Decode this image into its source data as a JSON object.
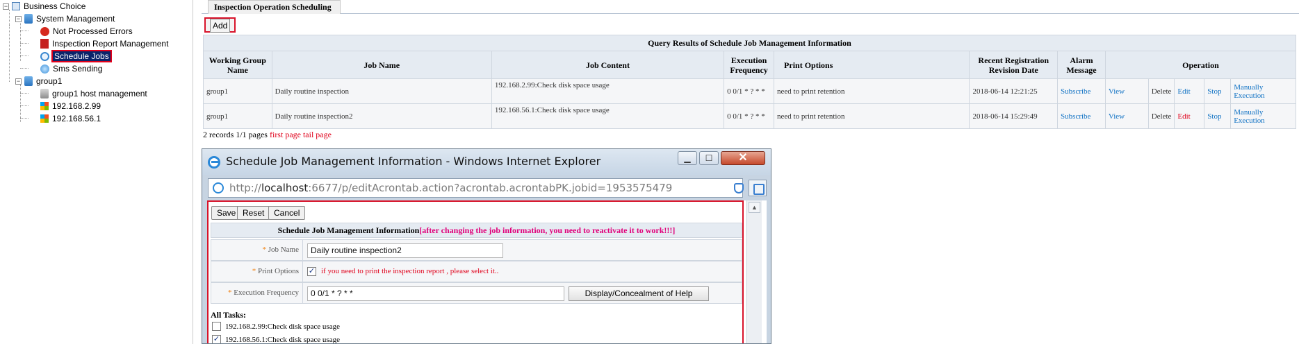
{
  "tree": {
    "root": "Business Choice",
    "system_management": "System Management",
    "not_processed_errors": "Not Processed Errors",
    "inspection_report_management": "Inspection Report Management",
    "schedule_jobs": "Schedule Jobs",
    "sms_sending": "Sms Sending",
    "group1": "group1",
    "group1_host_management": "group1 host management",
    "host1": "192.168.2.99",
    "host2": "192.168.56.1",
    "expand_glyph": "−"
  },
  "tab": {
    "label": "Inspection Operation Scheduling"
  },
  "toolbar": {
    "add_label": "Add"
  },
  "results": {
    "caption": "Query Results of Schedule Job Management Information",
    "columns": [
      "Working Group Name",
      "Job Name",
      "Job Content",
      "Execution Frequency",
      "Print Options",
      "Recent Registration Revision Date",
      "Alarm Message",
      "Operation"
    ],
    "rows": [
      {
        "group": "group1",
        "job_name": "Daily routine inspection",
        "job_content": "192.168.2.99:Check disk space usage",
        "frequency": "0 0/1 * ? * *",
        "print_options": "need to print retention",
        "date": "2018-06-14 12:21:25",
        "alarm": "Subscribe",
        "view": "View",
        "delete": "Delete",
        "edit": "Edit",
        "stop": "Stop",
        "manual": "Manually Execution"
      },
      {
        "group": "group1",
        "job_name": "Daily routine inspection2",
        "job_content": "192.168.56.1:Check disk space usage",
        "frequency": "0 0/1 * ? * *",
        "print_options": "need to print retention",
        "date": "2018-06-14 15:29:49",
        "alarm": "Subscribe",
        "view": "View",
        "delete": "Delete",
        "edit": "Edit",
        "stop": "Stop",
        "manual": "Manually Execution"
      }
    ]
  },
  "pager": {
    "summary": "2 records 1/1 pages",
    "first": "first page",
    "tail": "tail page"
  },
  "popup": {
    "title": "Schedule Job Management Information - Windows Internet Explorer",
    "address_prefix": "http://",
    "address_host": "localhost",
    "address_rest": ":6677/p/editAcrontab.action?acrontab.acrontabPK.jobid=1953575479",
    "minimize": "▁",
    "maximize": "☐",
    "close": "✕",
    "save": "Save",
    "reset": "Reset",
    "cancel": "Cancel",
    "form_title": "Schedule Job Management Information",
    "form_warning": "[after changing the job information, you need to reactivate it to work!!!]",
    "asterisk": "*",
    "job_name_label": "Job Name",
    "job_name_value": "Daily routine inspection2",
    "print_options_label": "Print Options",
    "print_checked": "✓",
    "print_hint": "if you need to print the inspection report , please select it..",
    "frequency_label": "Execution Frequency",
    "frequency_value": "0 0/1 * ? * *",
    "help_button": "Display/Concealment of Help",
    "all_tasks_label": "All Tasks:",
    "tasks": [
      {
        "label": "192.168.2.99:Check disk space usage",
        "checked": ""
      },
      {
        "label": "192.168.56.1:Check disk space usage",
        "checked": "✓"
      }
    ],
    "scroll_up": "▲"
  }
}
